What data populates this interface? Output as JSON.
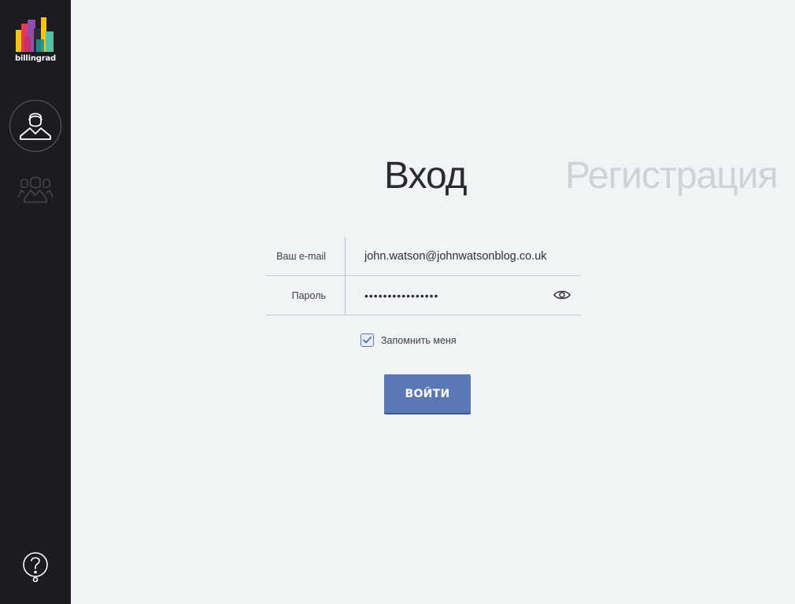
{
  "brand": {
    "name": "billingrad",
    "colors": [
      "#f2c418",
      "#e53a57",
      "#8f4fb0",
      "#2aa59a",
      "#57c1a4"
    ]
  },
  "sidebar": {
    "items": [
      {
        "icon": "user-icon",
        "active": true
      },
      {
        "icon": "group-icon",
        "active": false
      },
      {
        "icon": "help-icon",
        "active": false
      }
    ]
  },
  "tabs": {
    "login": "Вход",
    "register": "Регистрация",
    "active": "login"
  },
  "form": {
    "email_label": "Ваш e-mail",
    "email_value": "john.watson@johnwatsonblog.co.uk",
    "password_label": "Пароль",
    "password_value": "••••••••••••••••",
    "remember_label": "Запомнить меня",
    "remember_checked": true,
    "submit_label": "ВОЙТИ"
  },
  "colors": {
    "sidebar_bg": "#1b1b20",
    "page_bg": "#f1f4f5",
    "accent": "#5a77b6"
  }
}
